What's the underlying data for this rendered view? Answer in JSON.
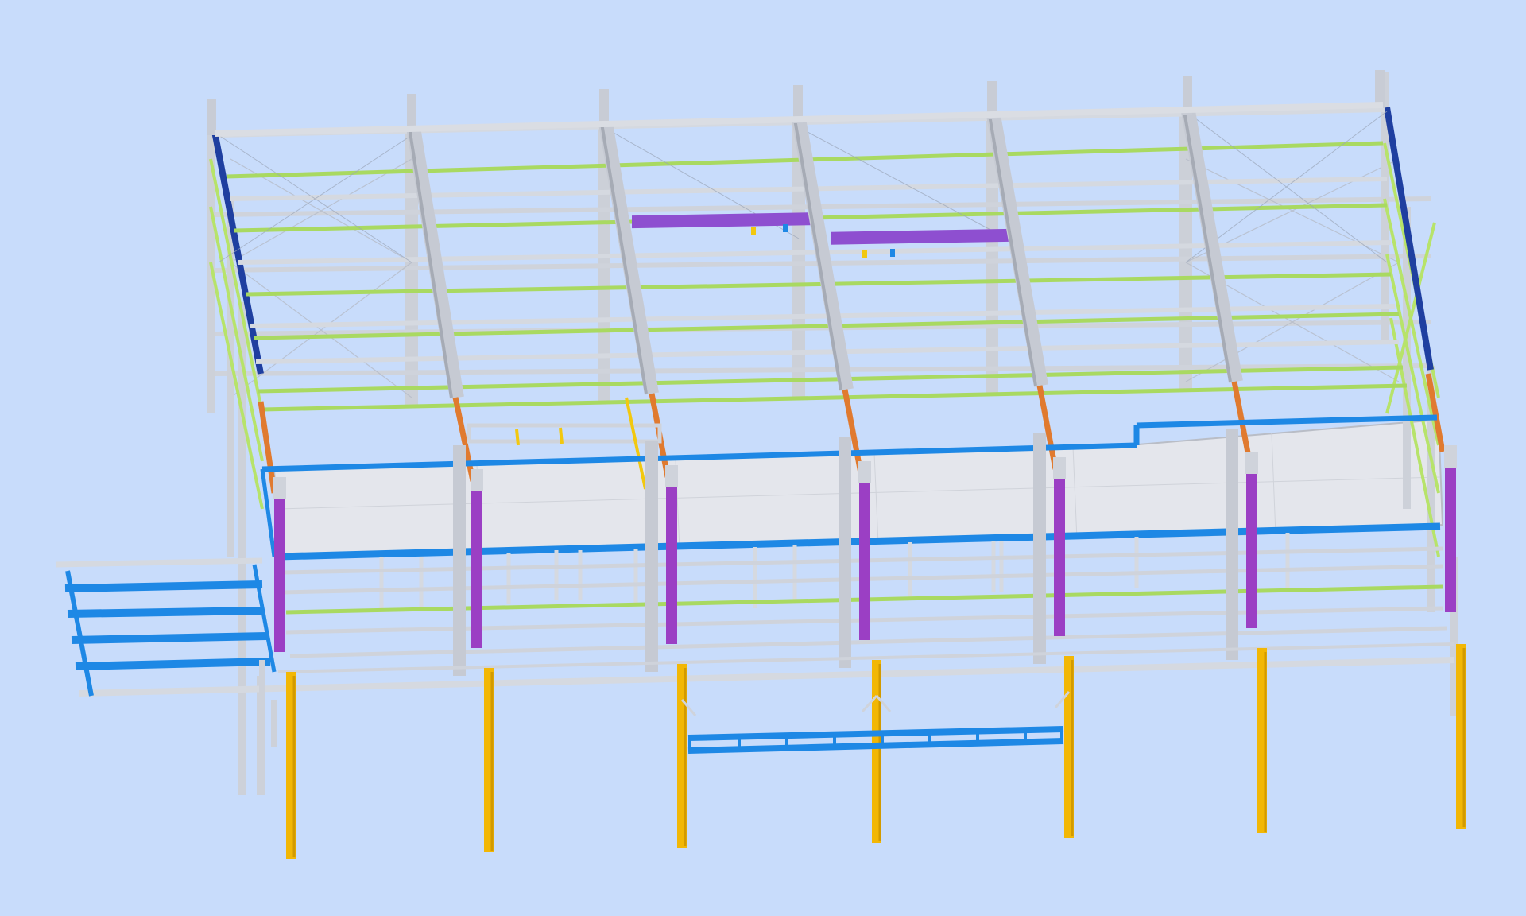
{
  "viewport": {
    "background": "#c8dcfb",
    "model": "steel-frame-structure-3d-view"
  },
  "colors": {
    "primary_steel": "#cfd3db",
    "primary_steel_shade": "#a9aeb8",
    "roof_purlin": "#9fd45a",
    "eave_beam": "#1e88e5",
    "edge_rafter": "#1f3fa0",
    "haunch": "#e07a2f",
    "mezzanine_column": "#9b3fc4",
    "ground_column": "#f2b705",
    "floor_slab": "#e4e6ec",
    "trimmer": "#8e4fd0",
    "ladder": "#f2c80f"
  }
}
